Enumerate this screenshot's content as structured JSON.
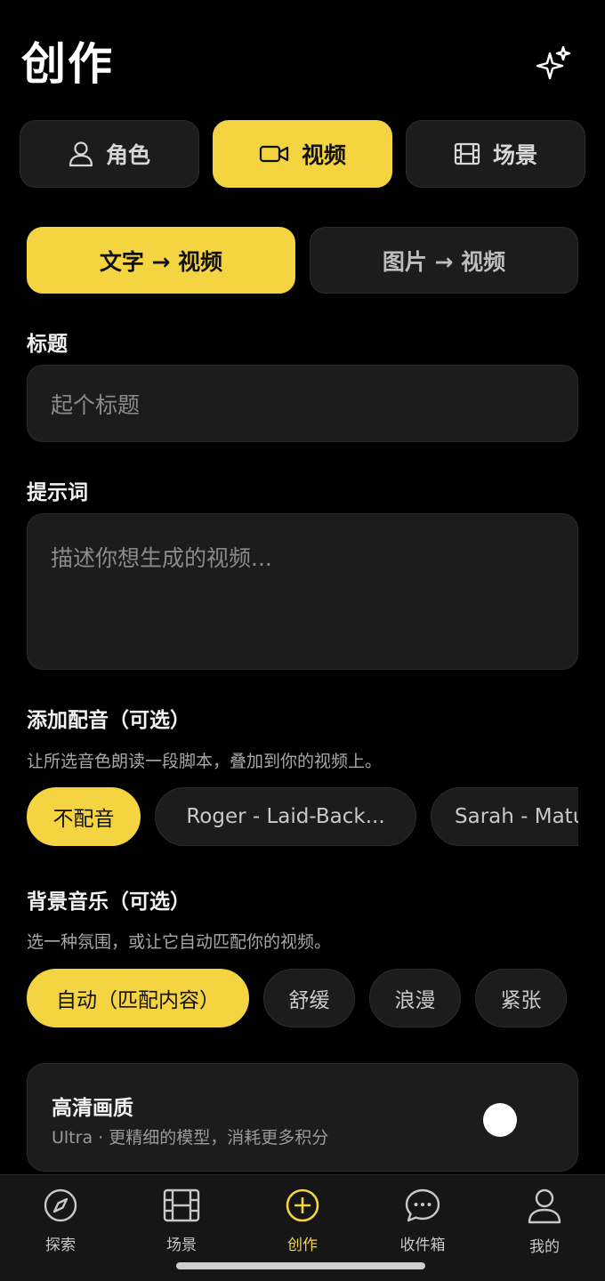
{
  "header": {
    "title": "创作"
  },
  "type_tabs": [
    {
      "label": "角色",
      "icon": "person-icon",
      "active": false
    },
    {
      "label": "视频",
      "icon": "video-camera-icon",
      "active": true
    },
    {
      "label": "场景",
      "icon": "film-icon",
      "active": false
    }
  ],
  "mode_tabs": [
    {
      "label": "文字 → 视频",
      "active": true
    },
    {
      "label": "图片 → 视频",
      "active": false
    }
  ],
  "title_section": {
    "label": "标题",
    "placeholder": "起个标题"
  },
  "prompt_section": {
    "label": "提示词",
    "placeholder": "描述你想生成的视频..."
  },
  "voice_section": {
    "label": "添加配音（可选）",
    "description": "让所选音色朗读一段脚本，叠加到你的视频上。",
    "options": [
      "不配音",
      "Roger - Laid-Back...",
      "Sarah - Matu"
    ],
    "selected": "不配音"
  },
  "music_section": {
    "label": "背景音乐（可选）",
    "description": "选一种氛围，或让它自动匹配你的视频。",
    "options": [
      "自动（匹配内容）",
      "舒缓",
      "浪漫",
      "紧张"
    ],
    "selected": "自动（匹配内容）"
  },
  "hd_card": {
    "title": "高清画质",
    "description": "Ultra · 更精细的模型，消耗更多积分",
    "enabled": false
  },
  "bottom_nav": [
    {
      "label": "探索",
      "icon": "compass-icon",
      "active": false
    },
    {
      "label": "场景",
      "icon": "film-icon",
      "active": false
    },
    {
      "label": "创作",
      "icon": "plus-circle-icon",
      "active": true
    },
    {
      "label": "收件箱",
      "icon": "chat-bubble-icon",
      "active": false
    },
    {
      "label": "我的",
      "icon": "person-icon",
      "active": false
    }
  ],
  "colors": {
    "accent": "#f5d442",
    "background": "#000000",
    "surface": "#1c1c1c"
  }
}
